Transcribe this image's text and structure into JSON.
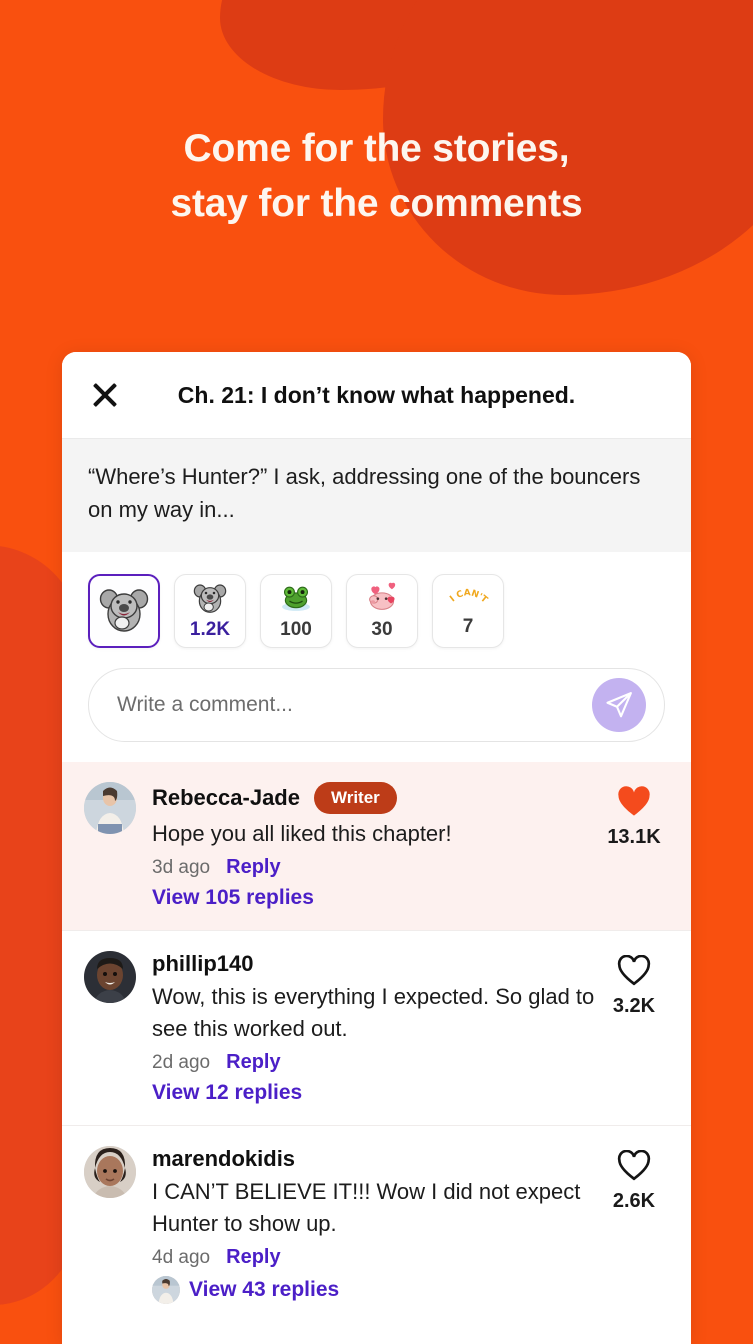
{
  "theme": {
    "background_orange": "#f9500f",
    "blob_orange": "#dd3c14",
    "accent_purple": "#4b1fc7",
    "writer_badge": "#bd3c18",
    "heart_filled": "#f44b1d",
    "writer_row_bg": "#fdf1ef"
  },
  "promo": {
    "headline_line1": "Come for the stories,",
    "headline_line2": "stay for the comments"
  },
  "app": {
    "nav_glyphs": [
      "square-icon",
      "circle-icon",
      "triangle-icon"
    ],
    "close_icon": "close-icon",
    "chapter_title": "Ch. 21: I don’t know what happened.",
    "excerpt": "“Where’s Hunter?” I ask, addressing one of the bouncers on my way in..."
  },
  "reactions": [
    {
      "art": "koala-sticker",
      "count": "",
      "selected": true
    },
    {
      "art": "koala-sticker",
      "count": "1.2K",
      "selected": false
    },
    {
      "art": "frog-sticker",
      "count": "100",
      "selected": false
    },
    {
      "art": "pig-hearts-sticker",
      "count": "30",
      "selected": false
    },
    {
      "art": "i-cant-sticker",
      "count": "7",
      "selected": false
    }
  ],
  "composer": {
    "placeholder": "Write a comment...",
    "value": "",
    "send_icon": "send-icon"
  },
  "comments": [
    {
      "username": "Rebecca-Jade",
      "badge": "Writer",
      "text": "Hope you all liked this chapter!",
      "time_ago": "3d ago",
      "reply_label": "Reply",
      "view_replies": "View 105 replies",
      "replies_has_avatar": false,
      "likes": "13.1K",
      "liked": true,
      "is_writer": true,
      "avatar": "rebecca-jade-avatar"
    },
    {
      "username": "phillip140",
      "badge": "",
      "text": "Wow, this is everything I expected. So glad to see this worked out.",
      "time_ago": "2d ago",
      "reply_label": "Reply",
      "view_replies": "View 12 replies",
      "replies_has_avatar": false,
      "likes": "3.2K",
      "liked": false,
      "is_writer": false,
      "avatar": "phillip140-avatar"
    },
    {
      "username": "marendokidis",
      "badge": "",
      "text": "I CAN’T BELIEVE IT!!! Wow I did not expect Hunter to show up.",
      "time_ago": "4d ago",
      "reply_label": "Reply",
      "view_replies": "View 43 replies",
      "replies_has_avatar": true,
      "likes": "2.6K",
      "liked": false,
      "is_writer": false,
      "avatar": "marendokidis-avatar"
    }
  ]
}
